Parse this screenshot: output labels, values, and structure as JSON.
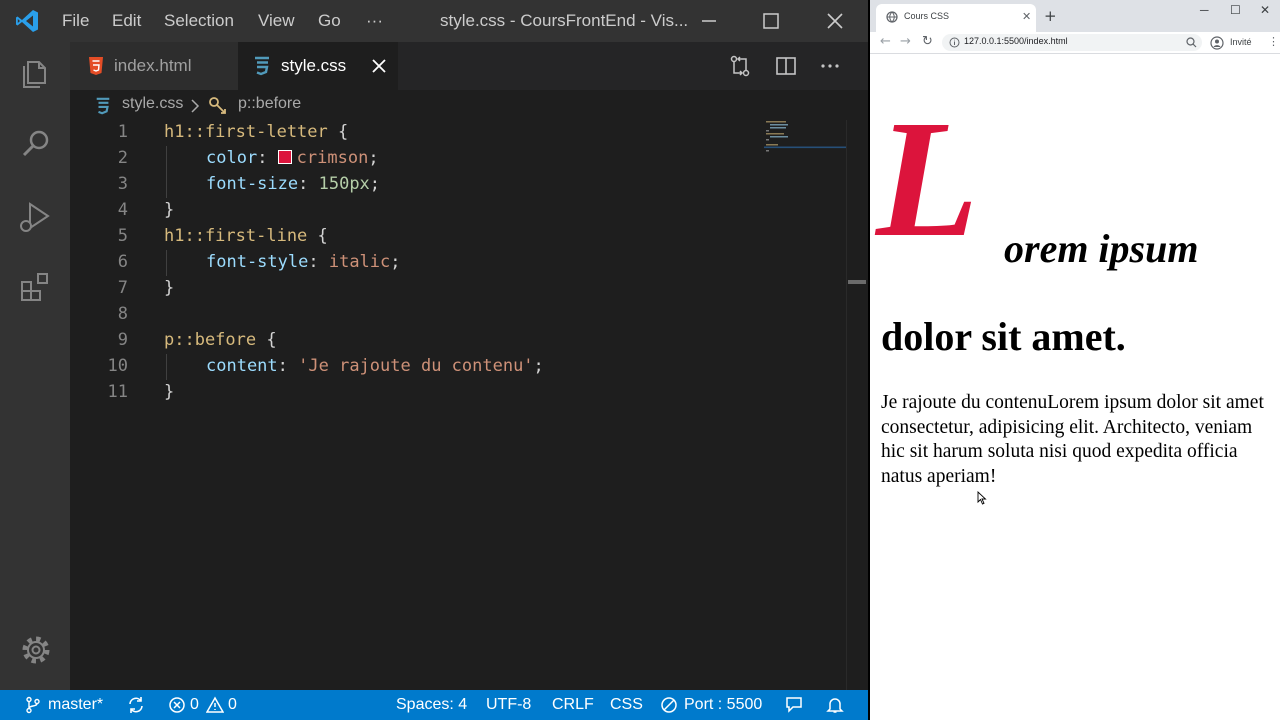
{
  "vscode": {
    "menu": [
      "File",
      "Edit",
      "Selection",
      "View",
      "Go",
      "···"
    ],
    "window_title": "style.css - CoursFrontEnd - Vis...",
    "tabs": [
      {
        "label": "index.html",
        "icon": "html5-icon",
        "active": false
      },
      {
        "label": "style.css",
        "icon": "css3-icon",
        "active": true
      }
    ],
    "breadcrumb": {
      "file": "style.css",
      "symbol": "p::before"
    },
    "line_numbers": [
      "1",
      "2",
      "3",
      "4",
      "5",
      "6",
      "7",
      "8",
      "9",
      "10",
      "11"
    ],
    "code": {
      "l1": {
        "selector": "h1::first-letter",
        "brace": " {"
      },
      "l2": {
        "prop": "color",
        "colon": ": ",
        "value": "crimson",
        "semi": ";"
      },
      "l3": {
        "prop": "font-size",
        "colon": ": ",
        "value": "150px",
        "semi": ";"
      },
      "l4": "}",
      "l5": {
        "selector": "h1::first-line",
        "brace": " {"
      },
      "l6": {
        "prop": "font-style",
        "colon": ": ",
        "value": "italic",
        "semi": ";"
      },
      "l7": "}",
      "l9": {
        "selector": "p::before",
        "brace": " {"
      },
      "l10": {
        "prop": "content",
        "colon": ": ",
        "value": "'Je rajoute du contenu'",
        "semi": ";"
      },
      "l11": "}"
    },
    "swatch_color": "#dc143c",
    "statusbar": {
      "branch": "master*",
      "errors": "0",
      "warnings": "0",
      "spaces": "Spaces: 4",
      "encoding": "UTF-8",
      "eol": "CRLF",
      "language": "CSS",
      "port": "Port : 5500"
    },
    "accent": "#007acc"
  },
  "browser": {
    "tab_title": "Cours CSS",
    "url": "127.0.0.1:5500/index.html",
    "profile": "Invité",
    "page": {
      "h1_first_letter": "L",
      "h1_rest_line1": "orem ipsum",
      "h1_line2": "dolor sit amet.",
      "paragraph": "Je rajoute du contenuLorem ipsum dolor sit amet consectetur, adipisicing elit. Architecto, veniam hic sit harum soluta nisi quod expedita officia natus aperiam!"
    },
    "first_letter_color": "#dc143c"
  }
}
